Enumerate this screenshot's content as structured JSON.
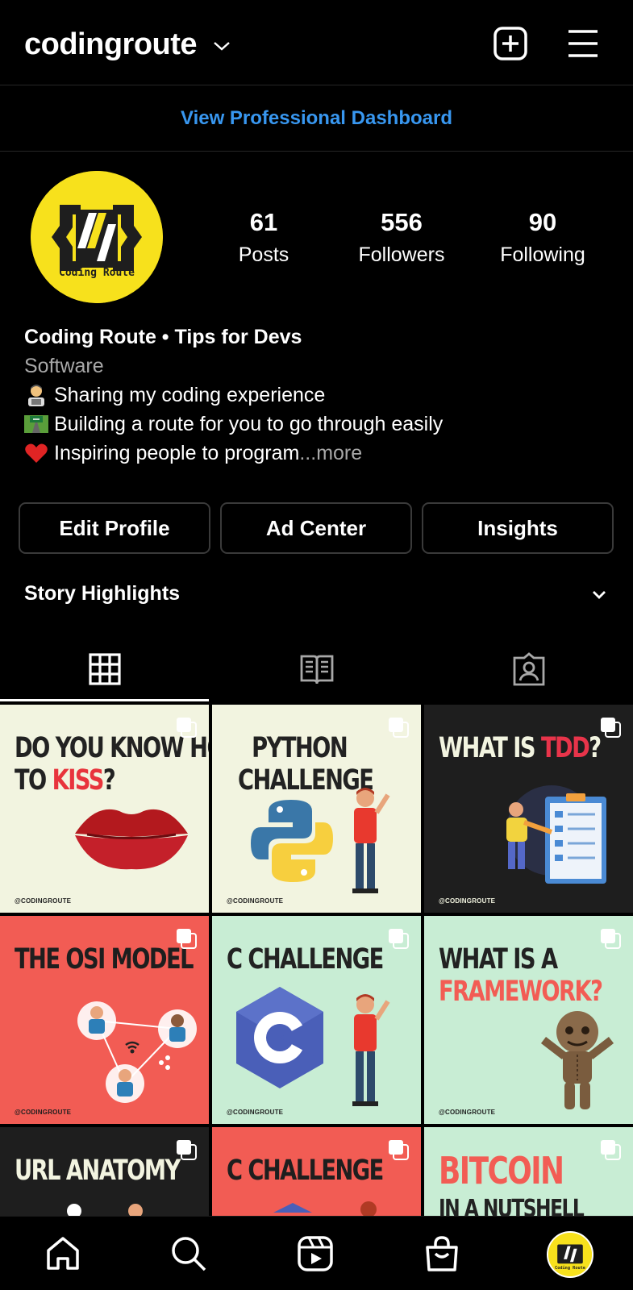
{
  "header": {
    "username": "codingroute"
  },
  "dashboard_link": "View Professional Dashboard",
  "profile": {
    "avatar_text": "Coding Route",
    "stats": [
      {
        "value": "61",
        "label": "Posts"
      },
      {
        "value": "556",
        "label": "Followers"
      },
      {
        "value": "90",
        "label": "Following"
      }
    ],
    "name": "Coding Route • Tips for Devs",
    "category": "Software",
    "bio_lines": [
      "Sharing my coding experience",
      "Building a route for you to go through easily",
      "Inspiring people to program"
    ],
    "bio_ellipsis": "...",
    "more": " more"
  },
  "buttons": {
    "edit_profile": "Edit Profile",
    "ad_center": "Ad Center",
    "insights": "Insights"
  },
  "highlights_title": "Story Highlights",
  "tabs": [
    "grid-icon",
    "guides-icon",
    "tagged-icon"
  ],
  "posts": [
    {
      "title_a": "DO YOU KNOW HOW",
      "title_b": "TO ",
      "title_hl": "KISS",
      "title_c": "?",
      "handle": "@CODINGROUTE",
      "bg": "#f2f4e0",
      "fg": "#222222",
      "hl": "#e8343c"
    },
    {
      "title_a": "PYTHON",
      "title_b": "CHALLENGE",
      "handle": "@CODINGROUTE",
      "bg": "#f2f4e0",
      "fg": "#222222"
    },
    {
      "title_a": "WHAT IS ",
      "title_hl": "TDD",
      "title_c": "?",
      "handle": "@CODINGROUTE",
      "bg": "#1e1e1e",
      "fg": "#f2f4e0",
      "hl": "#e8344a"
    },
    {
      "title_a": "THE OSI MODEL",
      "handle": "@CODINGROUTE",
      "bg": "#f25c54",
      "fg": "#1e1e1e"
    },
    {
      "title_a": "C CHALLENGE",
      "handle": "@CODINGROUTE",
      "bg": "#c8edd4",
      "fg": "#222222"
    },
    {
      "title_a": "WHAT IS A",
      "title_b": "FRAMEWORK?",
      "handle": "@CODINGROUTE",
      "bg": "#c8edd4",
      "fg": "#222222",
      "hl": "#f25c54"
    },
    {
      "title_a": "URL ANATOMY",
      "bg": "#1e1e1e",
      "fg": "#f2f4e0"
    },
    {
      "title_a": "C CHALLENGE",
      "bg": "#f25c54",
      "fg": "#1e1e1e"
    },
    {
      "title_a": "BITCOIN",
      "title_b": "IN A NUTSHELL",
      "bg": "#c8edd4",
      "fg": "#f25c54"
    }
  ],
  "nav": [
    "home-icon",
    "search-icon",
    "reels-icon",
    "shop-icon",
    "profile-avatar"
  ]
}
